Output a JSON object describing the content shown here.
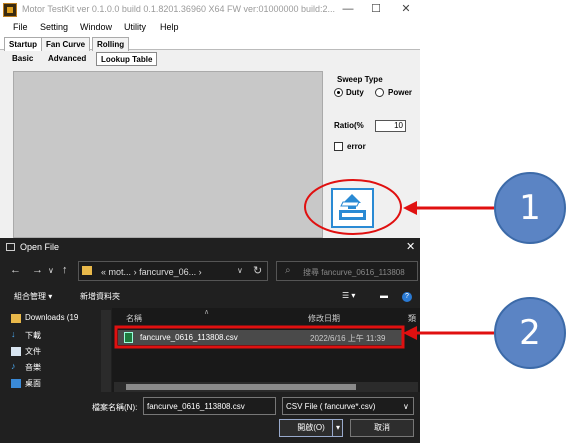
{
  "app": {
    "title": "Motor TestKit ver 0.1.0.0 build 0.1.8201.36960 X64  FW ver:01000000 build:2...",
    "menu": [
      "File",
      "Setting",
      "Window",
      "Utility",
      "Help"
    ],
    "tabs": [
      "Startup",
      "Fan Curve",
      "Rolling"
    ],
    "subtabs": [
      "Basic",
      "Advanced",
      "Lookup Table"
    ],
    "sweep_type_label": "Sweep Type",
    "sweep_options": [
      "Duty",
      "Power"
    ],
    "ratio_label": "Ratio(%",
    "ratio_value": "10",
    "error_label": "error"
  },
  "dialog": {
    "title": "Open File",
    "breadcrumb": [
      "«",
      "mot...",
      "›",
      "fancurve_06...",
      "›"
    ],
    "search_placeholder": "搜尋 fancurve_0616_113808",
    "organize_label": "組合管理 ▾",
    "new_folder_label": "新增資料夾",
    "sidebar": [
      "Downloads (19",
      "下載",
      "文件",
      "音樂",
      "桌面"
    ],
    "columns": [
      "名稱",
      "修改日期",
      "類"
    ],
    "file": {
      "name": "fancurve_0616_113808.csv",
      "date": "2022/6/16 上午 11:39"
    },
    "filename_label": "檔案名稱(N):",
    "filename_value": "fancurve_0616_113808.csv",
    "filter_value": "CSV File ( fancurve*.csv)",
    "open_label": "開啟(O)",
    "cancel_label": "取消"
  },
  "annotations": {
    "callout_1": "1",
    "callout_2": "2"
  },
  "colors": {
    "highlight_red": "#e01010",
    "callout_blue": "#5b84c4",
    "export_icon": "#2a8ad4"
  }
}
